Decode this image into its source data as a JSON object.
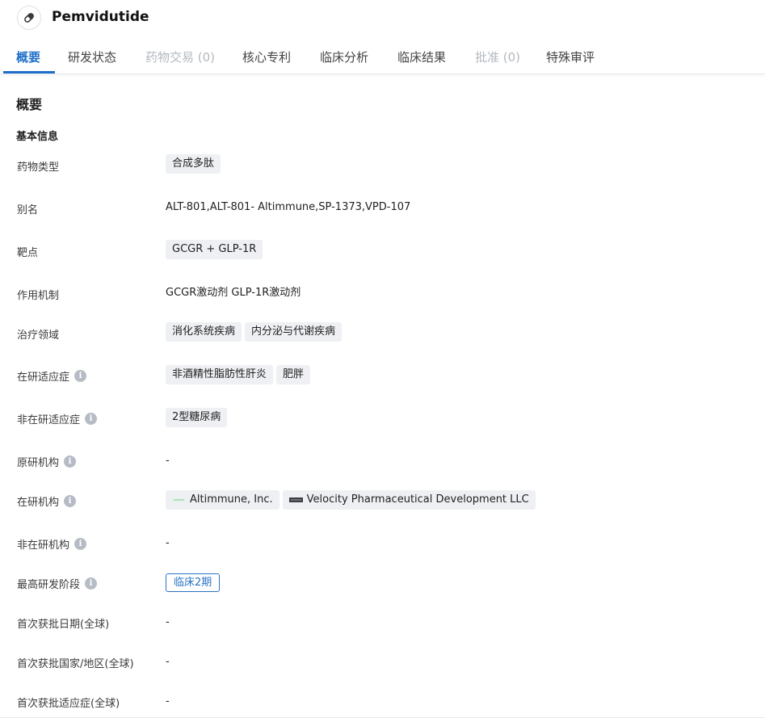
{
  "header": {
    "title": "Pemvidutide",
    "icon": "pill-icon"
  },
  "tabs": [
    {
      "label": "概要",
      "state": "active"
    },
    {
      "label": "研发状态",
      "state": "normal"
    },
    {
      "label": "药物交易 (0)",
      "state": "disabled"
    },
    {
      "label": "核心专利",
      "state": "normal"
    },
    {
      "label": "临床分析",
      "state": "normal"
    },
    {
      "label": "临床结果",
      "state": "normal"
    },
    {
      "label": "批准 (0)",
      "state": "disabled"
    },
    {
      "label": "特殊审评",
      "state": "normal"
    }
  ],
  "section": {
    "title": "概要",
    "subtitle": "基本信息"
  },
  "fields": {
    "drug_type": {
      "label": "药物类型",
      "tags": [
        "合成多肽"
      ]
    },
    "alias": {
      "label": "别名",
      "value": "ALT-801,ALT-801- Altimmune,SP-1373,VPD-107"
    },
    "target": {
      "label": "靶点",
      "tags": [
        "GCGR + GLP-1R"
      ]
    },
    "mechanism": {
      "label": "作用机制",
      "value": "GCGR激动剂  GLP-1R激动剂"
    },
    "therapeutic_area": {
      "label": "治疗领域",
      "tags": [
        "消化系统疾病",
        "内分泌与代谢疾病"
      ]
    },
    "active_indication": {
      "label": "在研适应症",
      "tags": [
        "非酒精性脂肪性肝炎",
        "肥胖"
      ]
    },
    "inactive_indication": {
      "label": "非在研适应症",
      "tags": [
        "2型糖尿病"
      ]
    },
    "originator": {
      "label": "原研机构",
      "value": "-"
    },
    "active_org": {
      "label": "在研机构",
      "orgs": [
        "Altimmune, Inc.",
        "Velocity Pharmaceutical Development LLC"
      ]
    },
    "inactive_org": {
      "label": "非在研机构",
      "value": "-"
    },
    "highest_phase": {
      "label": "最高研发阶段",
      "tag": "临床2期"
    },
    "first_approval_date": {
      "label": "首次获批日期(全球)",
      "value": "-"
    },
    "first_approval_country": {
      "label": "首次获批国家/地区(全球)",
      "value": "-"
    },
    "first_approval_indication": {
      "label": "首次获批适应症(全球)",
      "value": "-"
    }
  },
  "colors": {
    "accent": "#1f6fc9",
    "disabled_text": "#b3b8c0",
    "tag_bg": "#eef0f3"
  }
}
